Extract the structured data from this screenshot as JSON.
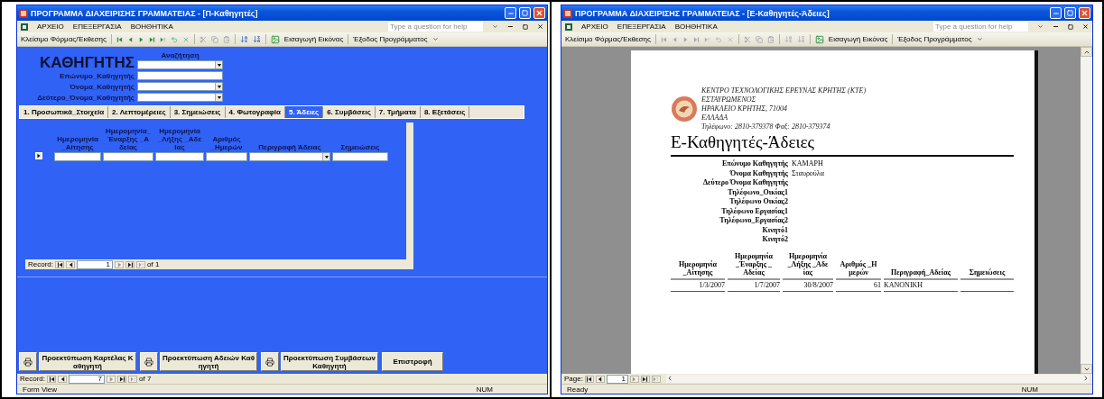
{
  "windows": [
    {
      "kind": "form",
      "title": "ΠΡΟΓΡΑΜΜΑ ΔΙΑΧΕΙΡΙΣΗΣ ΓΡΑΜΜΑΤΕΙΑΣ - [Π-Καθηγητές]",
      "menu": [
        "ΑΡΧΕΙΟ",
        "ΕΠΕΞΕΡΓΑΣΙΑ",
        "ΒΟΗΘΗΤΙΚΑ"
      ],
      "help_placeholder": "Type a question for help",
      "toolbar": {
        "close_label": "Κλείσιμο Φόρμας/Έκθεσης",
        "image_label": "Εισαγωγή Εικόνας",
        "exit_label": "Έξοδος Προγράμματος",
        "nav_enabled": true
      },
      "form": {
        "heading": "ΚΑΘΗΓΗΤΗΣ",
        "search_label": "Αναζήτηση",
        "fields": [
          {
            "label": "Επώνυμο_Καθηγητής",
            "kind": "text"
          },
          {
            "label": "Όνομα_Καθηγητής",
            "kind": "combo"
          },
          {
            "label": "Δεύτερο_Όνομα_Καθηγητής",
            "kind": "combo"
          }
        ],
        "tabs": [
          {
            "label": "1. Προσωπικά_Στοιχεία",
            "selected": false
          },
          {
            "label": "2. Λεπτομέρειες",
            "selected": false
          },
          {
            "label": "3. Σημειώσεις",
            "selected": false
          },
          {
            "label": "4. Φωτογραφία",
            "selected": false
          },
          {
            "label": "5. Άδειες",
            "selected": true
          },
          {
            "label": "6. Συμβάσεις",
            "selected": false
          },
          {
            "label": "7. Τμήματα",
            "selected": false
          },
          {
            "label": "8. Εξετάσεις",
            "selected": false
          }
        ],
        "subform": {
          "columns": [
            {
              "header": "Ημερομηνία _Αίτησης",
              "kind": "text"
            },
            {
              "header": "Ημερομηνία_ Έναρξης _Α δείας",
              "kind": "text"
            },
            {
              "header": "Ημερομηνία _Λήξης _Αδε ίας",
              "kind": "text"
            },
            {
              "header": "Αριθμός _Ημερών",
              "kind": "text"
            },
            {
              "header": "Περιγραφή Άδειας",
              "kind": "combo"
            },
            {
              "header": "Σημειώσεις",
              "kind": "text"
            }
          ],
          "nav": {
            "label": "Record:",
            "current": "1",
            "total": "of 1"
          }
        },
        "buttons": [
          {
            "label": "Προεκτύπωση Καρτέλας Κ αθηγητή",
            "kind": "print"
          },
          {
            "label": "Προεκτύπωση Αδειών Καθ ηγητή",
            "kind": "print"
          },
          {
            "label": "Προεκτύπωση Συμβάσεων Καθηγητή",
            "kind": "print"
          },
          {
            "label": "Επιστροφή",
            "kind": "plain"
          }
        ]
      },
      "nav": {
        "label": "Record:",
        "current": "7",
        "total": "of 7"
      },
      "status": {
        "left": "Form View",
        "right": "NUM"
      }
    },
    {
      "kind": "report",
      "title": "ΠΡΟΓΡΑΜΜΑ ΔΙΑΧΕΙΡΙΣΗΣ ΓΡΑΜΜΑΤΕΙΑΣ - [Ε-Καθηγητές-Άδειες]",
      "menu": [
        "ΑΡΧΕΙΟ",
        "ΕΠΕΞΕΡΓΑΣΙΑ",
        "ΒΟΗΘΗΤΙΚΑ"
      ],
      "help_placeholder": "Type a question for help",
      "toolbar": {
        "close_label": "Κλείσιμο Φόρμας/Έκθεσης",
        "image_label": "Εισαγωγή Εικόνας",
        "exit_label": "Έξοδος Προγράμματος",
        "nav_enabled": false
      },
      "report": {
        "address": [
          "ΚΕΝΤΡΟ ΤΕΧΝΟΛΟΓΙΚΗΣ ΕΡΕΥΝΑΣ ΚΡΗΤΗΣ (ΚΤΕ)",
          "ΕΣΤΑΥΡΩΜΕΝΟΣ",
          "ΗΡΑΚΛΕΙΟ ΚΡΗΤΗΣ,  71004",
          "ΕΛΛΑΔΑ",
          "Τηλέφωνο: 2810-379378  Φαξ: 2810-379374"
        ],
        "title": "Ε-Καθηγητές-Άδειες",
        "fields": [
          {
            "label": "Επώνυμο Καθηγητής",
            "value": "ΚΑΜΑΡΗ"
          },
          {
            "label": "Όνομα Καθηγητής",
            "value": "Σταυρούλα"
          },
          {
            "label": "Δεύτερο Όνομα Καθηγητής"
          },
          {
            "label": "Τηλέφωνο_Οικίας1"
          },
          {
            "label": "Τηλέφωνο Οικίας2"
          },
          {
            "label": "Τηλέφωνο Εργασίας1"
          },
          {
            "label": "Τηλέφωνο_Εργασίας2"
          },
          {
            "label": "Κινητό1"
          },
          {
            "label": "Κινητό2"
          }
        ],
        "columns": [
          "Ημερομηνία _Αίτησης",
          "Ημερομηνία _Έναρξης _ Αδείας",
          "Ημερομηνία _Λήξης _Αδε ίας",
          "Αριθμός _Η μερών",
          "Περιγραφή_Αδείας",
          "Σημειώσεις"
        ],
        "rows": [
          [
            "1/3/2007",
            "1/7/2007",
            "30/8/2007",
            "61",
            "ΚΑΝΟΝΙΚΗ"
          ]
        ]
      },
      "nav": {
        "label": "Page:",
        "current": "1"
      },
      "status": {
        "left": "Ready",
        "right": "NUM"
      }
    }
  ]
}
